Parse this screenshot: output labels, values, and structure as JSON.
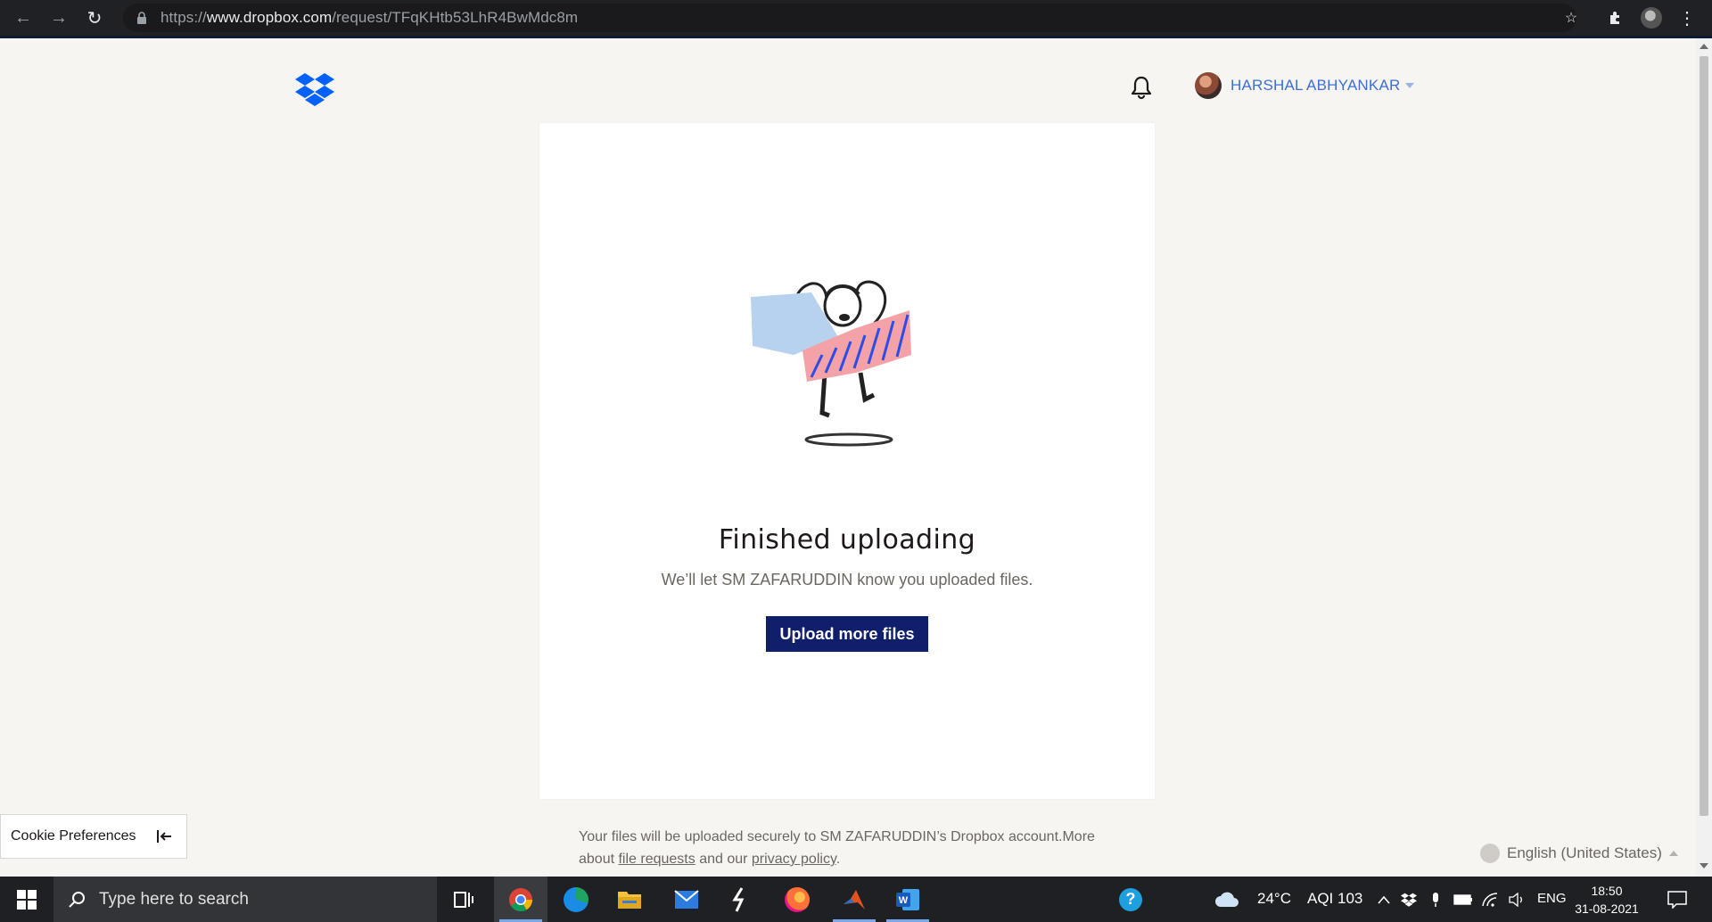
{
  "browser": {
    "url_prefix": "https://",
    "url_host": "www.dropbox.com",
    "url_path": "/request/TFqKHtb53LhR4BwMdc8m"
  },
  "header": {
    "user_name": "HARSHAL ABHYANKAR"
  },
  "card": {
    "title": "Finished uploading",
    "subtitle": "We’ll let SM ZAFARUDDIN know you uploaded files.",
    "button_label": "Upload more files"
  },
  "footer": {
    "text_part1": "Your files will be uploaded securely to SM ZAFARUDDIN’s Dropbox account.More about ",
    "link_file_requests": "file requests",
    "text_part2": " and our ",
    "link_privacy": "privacy policy",
    "text_part3": "."
  },
  "cookie": {
    "label": "Cookie Preferences"
  },
  "language": {
    "label": "English (United States)"
  },
  "taskbar": {
    "search_placeholder": "Type here to search",
    "weather": "24°C",
    "aqi": "AQI 103",
    "lang": "ENG",
    "time": "18:50",
    "date": "31-08-2021"
  },
  "colors": {
    "accent": "#0f1f6b",
    "dropbox_blue": "#0061fe",
    "user_link": "#3d6fd6"
  }
}
